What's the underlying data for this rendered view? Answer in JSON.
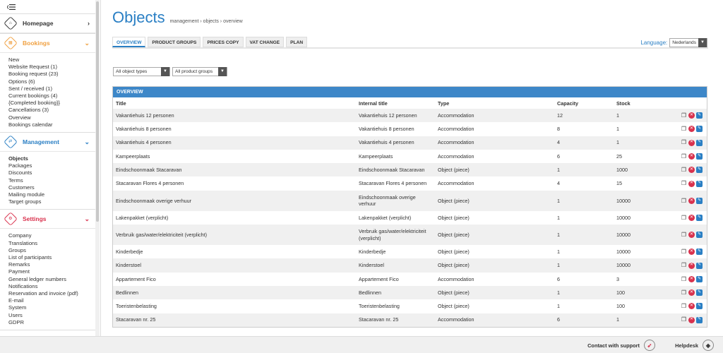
{
  "sidebar": {
    "menu_icon": "hamburger-icon",
    "sections": [
      {
        "title": "Homepage",
        "color": "#333333",
        "icon": "home-icon",
        "chevron": "›",
        "items": []
      },
      {
        "title": "Bookings",
        "color": "#f0a040",
        "icon": "calendar-icon",
        "chevron": "⌄",
        "items": [
          "New",
          "Website Request (1)",
          "Booking request (23)",
          "Options (6)",
          "Sent / received (1)",
          "Current bookings (4)",
          "{Completed booking}}",
          "Cancellations (3)",
          "Overview",
          "Bookings calendar"
        ]
      },
      {
        "title": "Management",
        "color": "#2a7fc4",
        "icon": "management-icon",
        "chevron": "⌄",
        "items": [
          "Objects",
          "Packages",
          "Discounts",
          "Terms",
          "Customers",
          "Mailing module",
          "Target groups"
        ]
      },
      {
        "title": "Settings",
        "color": "#d9314d",
        "icon": "settings-icon",
        "chevron": "⌄",
        "items": [
          "Company",
          "Translations",
          "Groups",
          "List of participants",
          "Remarks",
          "Payment",
          "General ledger numbers",
          "Notifications",
          "Reservation and invoice (pdf)",
          "E-mail",
          "System",
          "Users",
          "GDPR"
        ]
      }
    ]
  },
  "header": {
    "title": "Objects",
    "breadcrumb": "management › objects › overview"
  },
  "tabs": [
    "OVERVIEW",
    "PRODUCT GROUPS",
    "PRICES COPY",
    "VAT CHANGE",
    "PLAN"
  ],
  "language": {
    "label": "Language:",
    "value": "Nederlands"
  },
  "filters": {
    "object_types": "All object types",
    "product_groups": "All product groups"
  },
  "table": {
    "panel_title": "OVERVIEW",
    "columns": [
      "Title",
      "Internal title",
      "Type",
      "Capacity",
      "Stock"
    ],
    "rows": [
      [
        "Vakantiehuis 12 personen",
        "Vakantiehuis 12 personen",
        "Accommodation",
        "12",
        "1"
      ],
      [
        "Vakantiehuis 8 personen",
        "Vakantiehuis 8 personen",
        "Accommodation",
        "8",
        "1"
      ],
      [
        "Vakantiehuis 4 personen",
        "Vakantiehuis 4 personen",
        "Accommodation",
        "4",
        "1"
      ],
      [
        "Kampeerplaats",
        "Kampeerplaats",
        "Accommodation",
        "6",
        "25"
      ],
      [
        "Eindschoonmaak Stacaravan",
        "Eindschoonmaak Stacaravan",
        "Object (piece)",
        "1",
        "1000"
      ],
      [
        "Stacaravan Flores 4 personen",
        "Stacaravan Flores 4 personen",
        "Accommodation",
        "4",
        "15"
      ],
      [
        "Eindschoonmaak overige verhuur",
        "Eindschoonmaak overige verhuur",
        "Object (piece)",
        "1",
        "10000"
      ],
      [
        "Lakenpakket (verplicht)",
        "Lakenpakket (verplicht)",
        "Object (piece)",
        "1",
        "10000"
      ],
      [
        "Verbruik gas/water/elektriciteit (verplicht)",
        "Verbruik gas/water/elektriciteit (verplicht)",
        "Object (piece)",
        "1",
        "10000"
      ],
      [
        "Kinderbedje",
        "Kinderbedje",
        "Object (piece)",
        "1",
        "10000"
      ],
      [
        "Kinderstoel",
        "Kinderstoel",
        "Object (piece)",
        "1",
        "10000"
      ],
      [
        "Appartement Fico",
        "Appartement Fico",
        "Accommodation",
        "6",
        "3"
      ],
      [
        "Bedlinnen",
        "Bedlinnen",
        "Object (piece)",
        "1",
        "100"
      ],
      [
        "Toeristenbelasting",
        "Toeristenbelasting",
        "Object (piece)",
        "1",
        "100"
      ],
      [
        "Stacaravan nr. 25",
        "Stacaravan nr. 25",
        "Accommodation",
        "6",
        "1"
      ]
    ]
  },
  "footer": {
    "support": "Contact with support",
    "helpdesk": "Helpdesk"
  }
}
